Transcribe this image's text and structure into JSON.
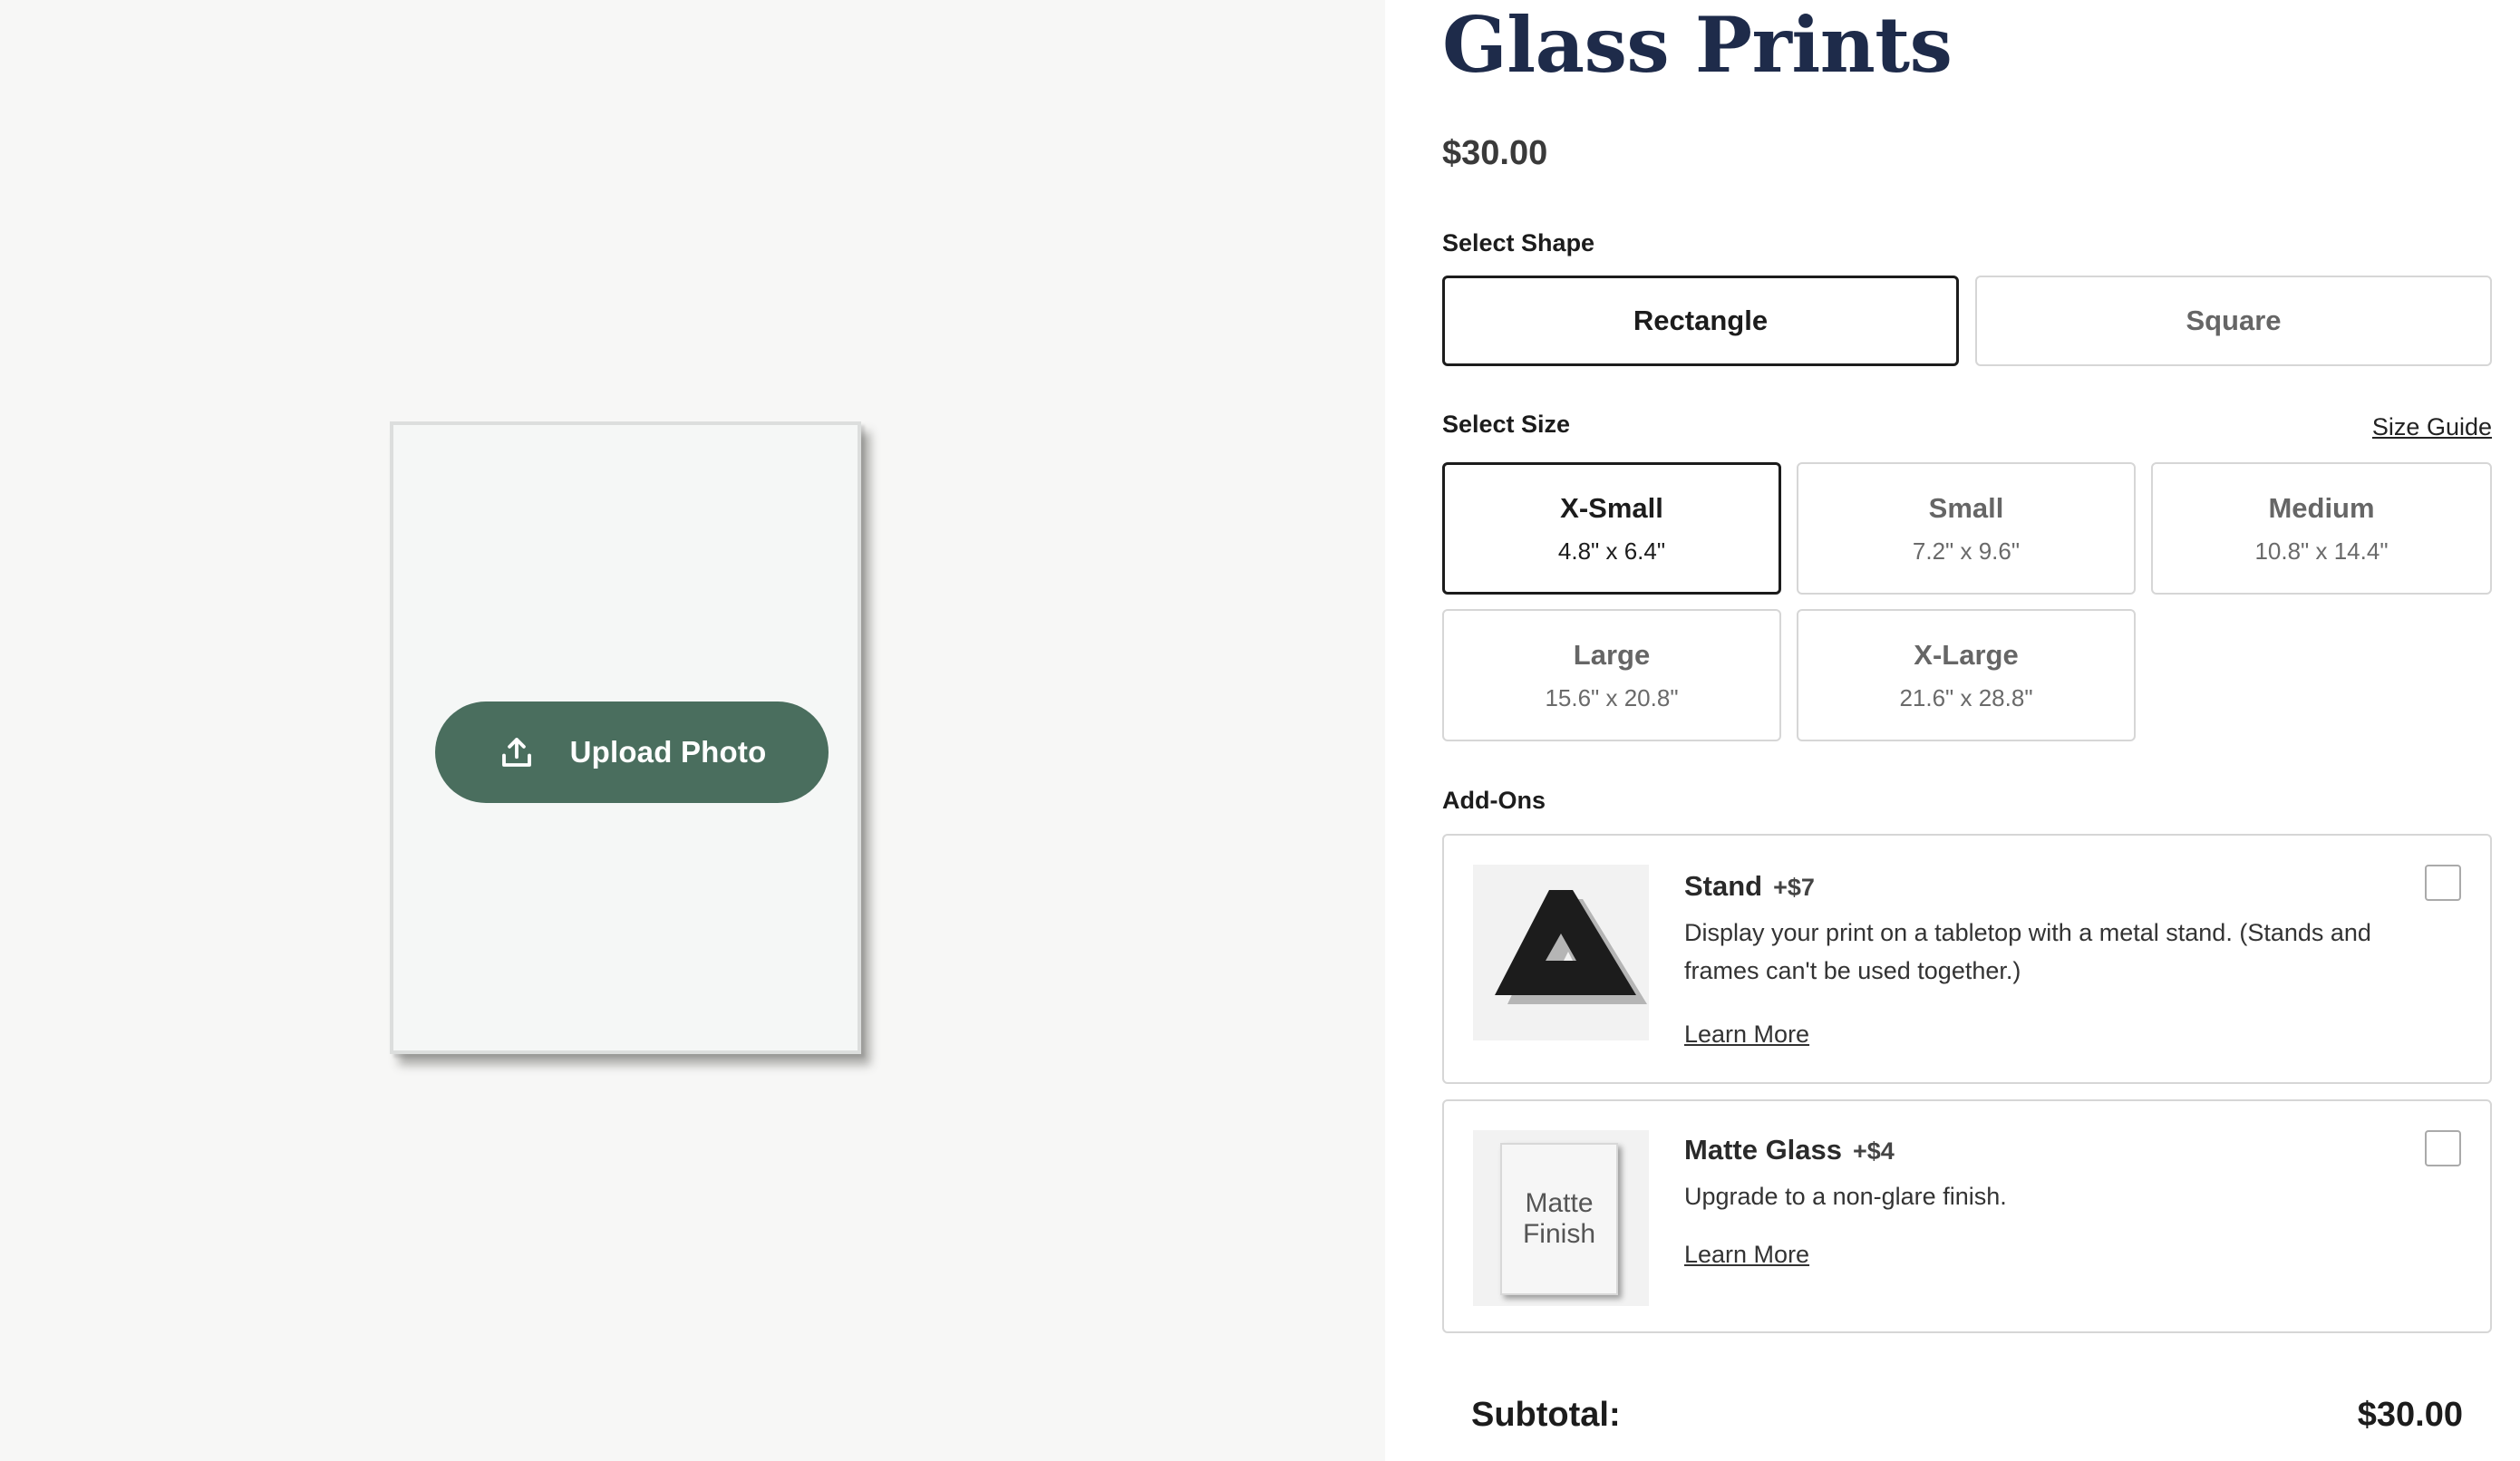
{
  "product": {
    "title": "Glass Prints",
    "price": "$30.00"
  },
  "preview": {
    "upload_label": "Upload Photo",
    "upload_icon": "upload-icon"
  },
  "shape": {
    "label": "Select Shape",
    "options": [
      {
        "name": "Rectangle",
        "selected": true
      },
      {
        "name": "Square",
        "selected": false
      }
    ]
  },
  "size": {
    "label": "Select Size",
    "guide_link": "Size Guide",
    "options": [
      {
        "name": "X-Small",
        "dims": "4.8\" x 6.4\"",
        "selected": true
      },
      {
        "name": "Small",
        "dims": "7.2\" x 9.6\"",
        "selected": false
      },
      {
        "name": "Medium",
        "dims": "10.8\" x 14.4\"",
        "selected": false
      },
      {
        "name": "Large",
        "dims": "15.6\" x 20.8\"",
        "selected": false
      },
      {
        "name": "X-Large",
        "dims": "21.6\" x 28.8\"",
        "selected": false
      }
    ]
  },
  "addons": {
    "label": "Add-Ons",
    "items": [
      {
        "name": "Stand",
        "price": "+$7",
        "desc_line1": "Display your print on a tabletop with a metal stand. (Stands and",
        "desc_line2": "frames can't be used together.)",
        "learn_more": "Learn More",
        "checked": false
      },
      {
        "name": "Matte Glass",
        "price": "+$4",
        "desc_line1": "Upgrade to a non-glare finish.",
        "learn_more": "Learn More",
        "thumb_line1": "Matte",
        "thumb_line2": "Finish",
        "checked": false
      }
    ]
  },
  "subtotal": {
    "label": "Subtotal:",
    "value": "$30.00"
  },
  "colors": {
    "accent_green": "#4a6e5e",
    "title_navy": "#1e2b4a",
    "preview_bg": "#f7f7f6"
  }
}
